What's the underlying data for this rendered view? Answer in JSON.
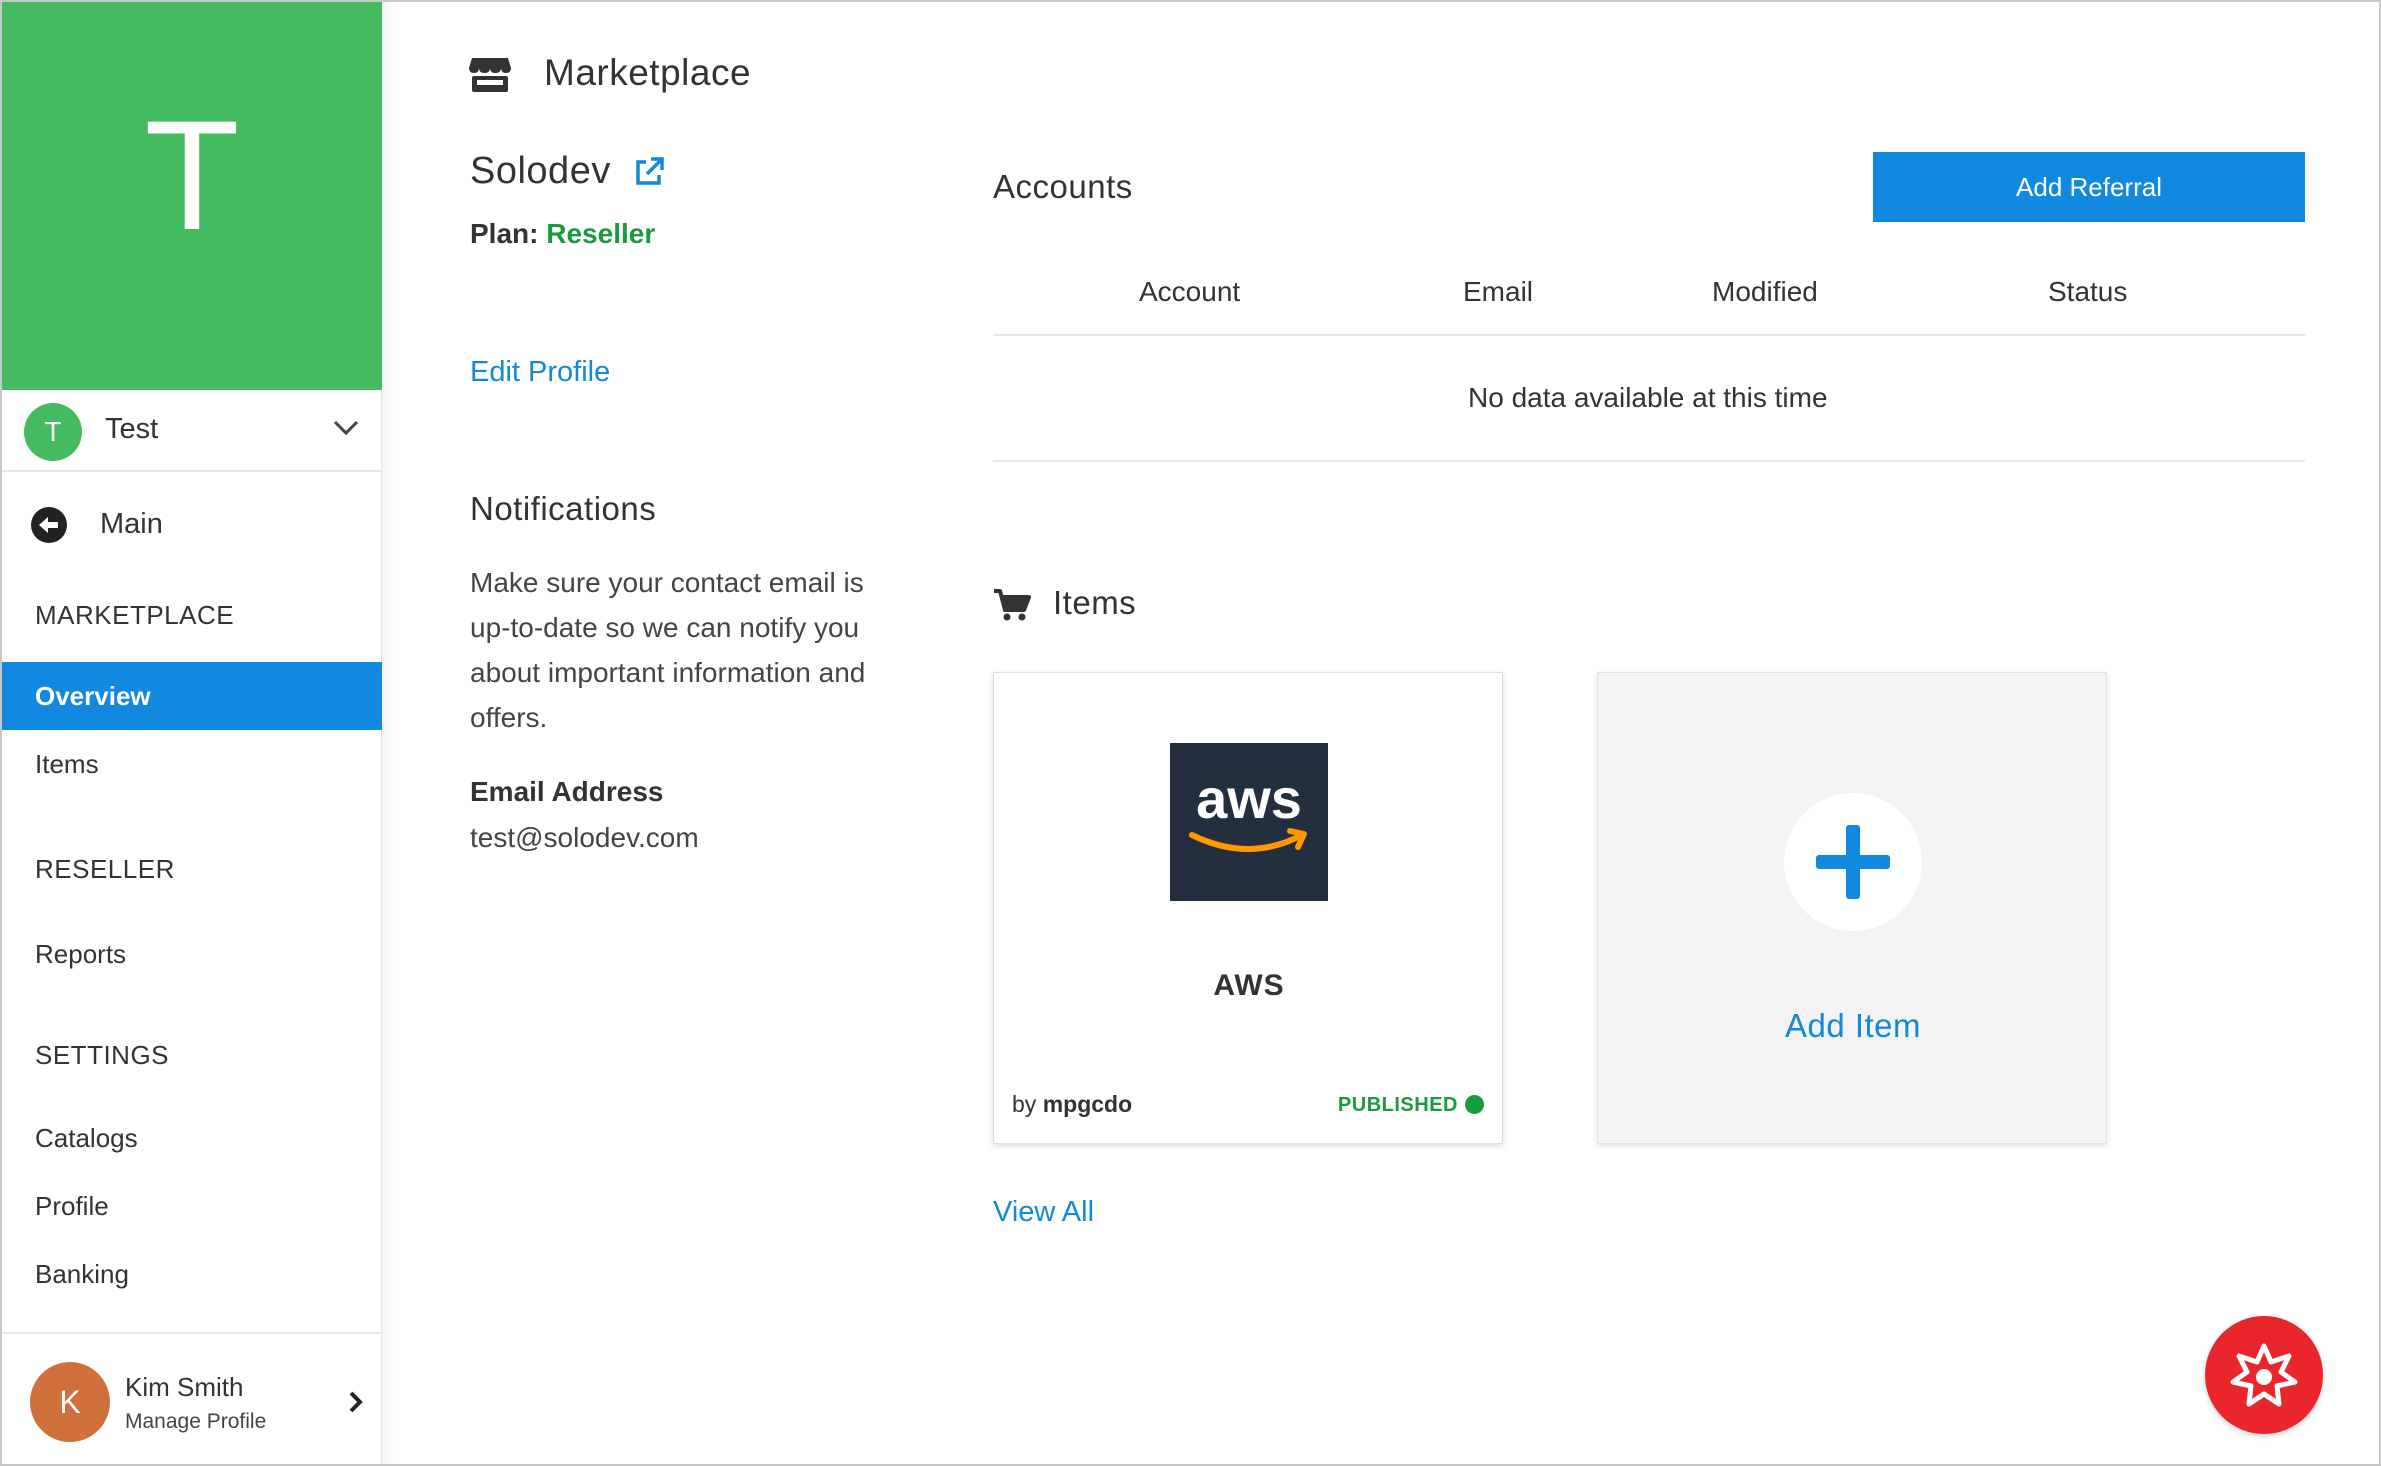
{
  "sidebar": {
    "brand_letter": "T",
    "account": {
      "avatar_letter": "T",
      "name": "Test"
    },
    "main_label": "Main",
    "sections": [
      {
        "title": "MARKETPLACE",
        "items": [
          "Overview",
          "Items"
        ]
      },
      {
        "title": "RESELLER",
        "items": [
          "Reports"
        ]
      },
      {
        "title": "SETTINGS",
        "items": [
          "Catalogs",
          "Profile",
          "Banking"
        ]
      }
    ],
    "active_item": "Overview",
    "user": {
      "avatar_letter": "K",
      "name": "Kim Smith",
      "subtitle": "Manage Profile"
    }
  },
  "header": {
    "title": "Marketplace",
    "icon": "store-icon"
  },
  "profile": {
    "org_name": "Solodev",
    "plan_label": "Plan:",
    "plan_value": "Reseller",
    "edit_link": "Edit Profile"
  },
  "notifications": {
    "title": "Notifications",
    "text": "Make sure your contact email is up-to-date so we can notify you about important information and offers.",
    "email_label": "Email Address",
    "email_value": "test@solodev.com"
  },
  "accounts": {
    "title": "Accounts",
    "add_button": "Add Referral",
    "columns": [
      "Account",
      "Email",
      "Modified",
      "Status"
    ],
    "empty_text": "No data available at this time"
  },
  "items": {
    "title": "Items",
    "cards": [
      {
        "logo_text": "aws",
        "name": "AWS",
        "by_prefix": "by",
        "author": "mpgcdo",
        "status": "PUBLISHED"
      }
    ],
    "add_label": "Add Item",
    "view_all": "View All"
  },
  "colors": {
    "brand_green": "#45bb5f",
    "primary_blue": "#1289e0",
    "status_green": "#1a9a3e",
    "fab_red": "#e8262b",
    "aws_navy": "#232f3e",
    "aws_orange": "#ff9900"
  }
}
